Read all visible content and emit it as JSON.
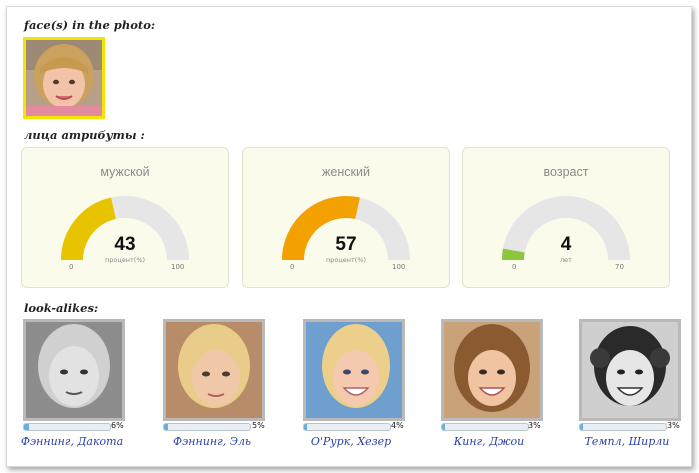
{
  "sections": {
    "faces_title": "face(s) in the photo:",
    "attributes_title": "лица атрибуты :",
    "lookalikes_title": "look-alikes:"
  },
  "face_icon": "child-face-photo",
  "gauges": [
    {
      "label": "мужской",
      "value": "43",
      "fraction": 0.43,
      "unit": "процент(%)",
      "min": "0",
      "max": "100",
      "color": "#e8c300"
    },
    {
      "label": "женский",
      "value": "57",
      "fraction": 0.57,
      "unit": "процент(%)",
      "min": "0",
      "max": "100",
      "color": "#f2a100"
    },
    {
      "label": "возраст",
      "value": "4",
      "fraction": 0.057,
      "unit": "лет",
      "min": "0",
      "max": "70",
      "color": "#8cc63f"
    }
  ],
  "lookalikes": [
    {
      "name": "Фэннинг, Дакота",
      "percent": "6%",
      "fraction": 0.06
    },
    {
      "name": "Фэннинг, Эль",
      "percent": "5%",
      "fraction": 0.05
    },
    {
      "name": "О'Рурк, Хезер",
      "percent": "4%",
      "fraction": 0.04
    },
    {
      "name": "Кинг, Джои",
      "percent": "3%",
      "fraction": 0.03
    },
    {
      "name": "Темпл, Ширли",
      "percent": "3%",
      "fraction": 0.03
    }
  ],
  "colors": {
    "gauge_track": "#e6e6e6",
    "card_bg": "#fbfbeb",
    "bar_fill": "#6aaee0",
    "link": "#2b3ea8"
  }
}
